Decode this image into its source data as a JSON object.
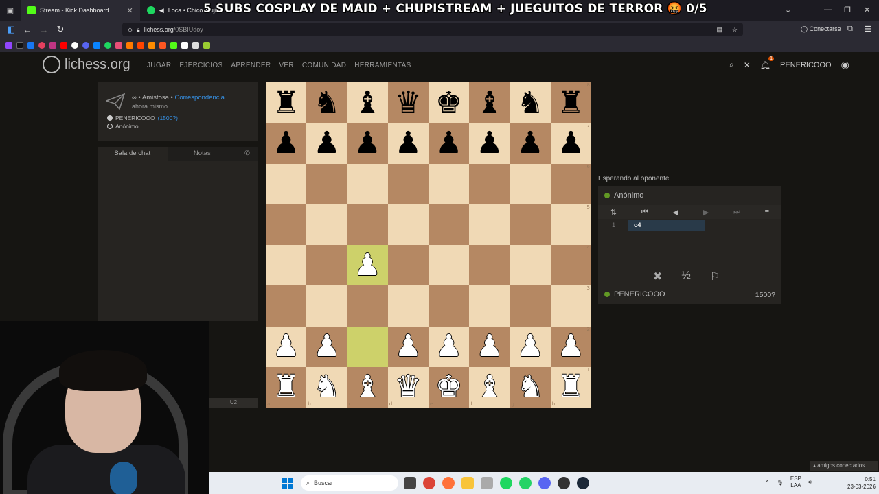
{
  "browser": {
    "tabs": [
      {
        "label": "Stream - Kick Dashboard",
        "color": "#53fc18"
      },
      {
        "label": "Loca • Chico Trujillo",
        "color": "#1ed760"
      }
    ],
    "stream_overlay": "5 SUBS COSPLAY DE MAID + CHUPISTREAM + JUEGUITOS DE TERROR 🤬 0/5",
    "url_host": "lichess.org",
    "url_path": "/0SBIUdoy",
    "account_label": "Conectarse"
  },
  "lichess": {
    "logo_text": "lichess.org",
    "menu": [
      "JUGAR",
      "EJERCICIOS",
      "APRENDER",
      "VER",
      "COMUNIDAD",
      "HERRAMIENTAS"
    ],
    "notif_count": "1",
    "username": "PENERICOOO"
  },
  "game_info": {
    "mode_prefix": "∞ • Amistosa • ",
    "mode_link": "Correspondencia",
    "time": "ahora mismo",
    "white_name": "PENERICOOO",
    "white_rating": "(1500?)",
    "black_name": "Anónimo"
  },
  "chat": {
    "tab_chat": "Sala de chat",
    "tab_notes": "Notas",
    "input_hint": "U2"
  },
  "board": {
    "ranks": [
      [
        "bR",
        "bN",
        "bB",
        "bQ",
        "bK",
        "bB",
        "bN",
        "bR"
      ],
      [
        "bP",
        "bP",
        "bP",
        "bP",
        "bP",
        "bP",
        "bP",
        "bP"
      ],
      [
        "",
        "",
        "",
        "",
        "",
        "",
        "",
        ""
      ],
      [
        "",
        "",
        "",
        "",
        "",
        "",
        "",
        ""
      ],
      [
        "",
        "",
        "wP",
        "",
        "",
        "",
        "",
        ""
      ],
      [
        "",
        "",
        "",
        "",
        "",
        "",
        "",
        ""
      ],
      [
        "wP",
        "wP",
        "",
        "wP",
        "wP",
        "wP",
        "wP",
        "wP"
      ],
      [
        "wR",
        "wN",
        "wB",
        "wQ",
        "wK",
        "wB",
        "wN",
        "wR"
      ]
    ],
    "highlight": [
      [
        4,
        2
      ],
      [
        6,
        2
      ]
    ],
    "files": [
      "a",
      "b",
      "c",
      "d",
      "e",
      "f",
      "g",
      "h"
    ],
    "rank_labels": [
      "8",
      "7",
      "6",
      "5",
      "4",
      "3",
      "2",
      "1"
    ]
  },
  "right_panel": {
    "status": "Esperando al oponente",
    "top_player": "Anónimo",
    "move_number": "1",
    "move": "c4",
    "bottom_player": "PENERICOOO",
    "bottom_rating": "1500?",
    "online_color": "#629924"
  },
  "footer": {
    "friends": "amigos conectados",
    "search_placeholder": "Buscar",
    "lang_top": "ESP",
    "lang_bottom": "LAA",
    "time": "0:51",
    "date": "23-03-2026"
  }
}
